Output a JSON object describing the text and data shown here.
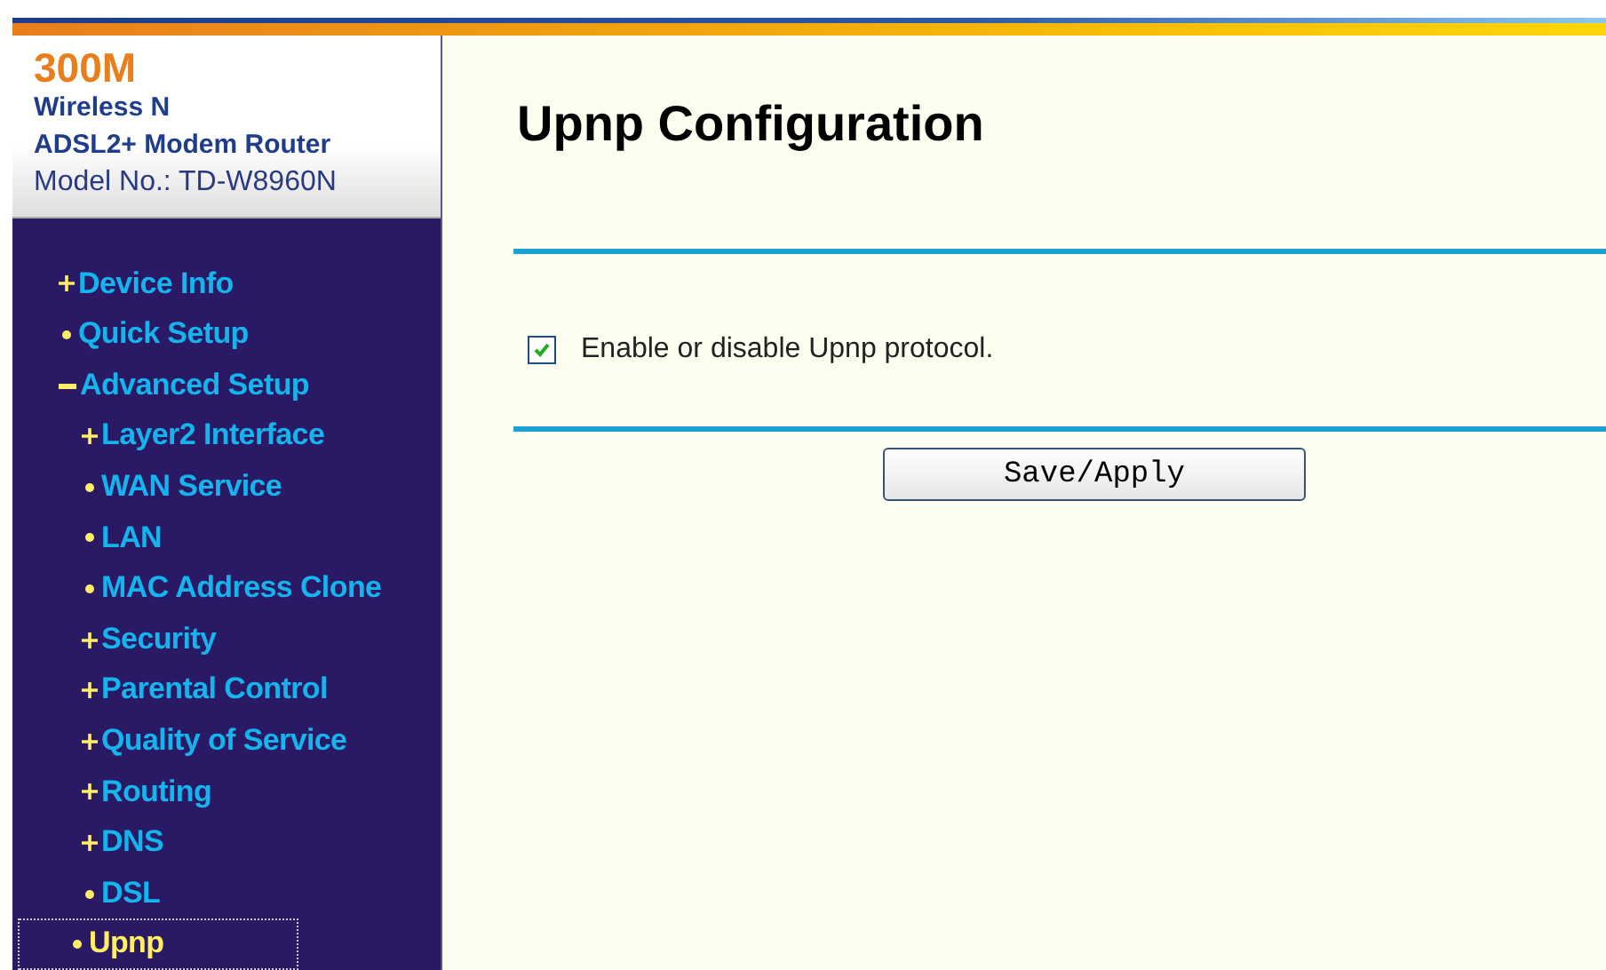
{
  "brand": {
    "capacity": "300M",
    "line1": "Wireless N",
    "line2": "ADSL2+ Modem Router",
    "model": "Model No.: TD-W8960N"
  },
  "menu": [
    {
      "label": "Device Info",
      "kind": "group",
      "expanded": false,
      "selected": false
    },
    {
      "label": "Quick Setup",
      "kind": "page",
      "selected": false
    },
    {
      "label": "Advanced Setup",
      "kind": "group",
      "expanded": true,
      "selected": false,
      "children": [
        {
          "label": "Layer2 Interface",
          "kind": "group",
          "expanded": false,
          "selected": false
        },
        {
          "label": "WAN Service",
          "kind": "page",
          "selected": false
        },
        {
          "label": "LAN",
          "kind": "page",
          "selected": false
        },
        {
          "label": "MAC Address Clone",
          "kind": "page",
          "selected": false
        },
        {
          "label": "Security",
          "kind": "group",
          "expanded": false,
          "selected": false
        },
        {
          "label": "Parental Control",
          "kind": "group",
          "expanded": false,
          "selected": false
        },
        {
          "label": "Quality of Service",
          "kind": "group",
          "expanded": false,
          "selected": false
        },
        {
          "label": "Routing",
          "kind": "group",
          "expanded": false,
          "selected": false
        },
        {
          "label": "DNS",
          "kind": "group",
          "expanded": false,
          "selected": false
        },
        {
          "label": "DSL",
          "kind": "page",
          "selected": false
        },
        {
          "label": "Upnp",
          "kind": "page",
          "selected": true
        }
      ]
    }
  ],
  "page": {
    "title": "Upnp Configuration",
    "option": {
      "label": "Enable or disable Upnp protocol.",
      "checked": true
    },
    "button": "Save/Apply"
  }
}
